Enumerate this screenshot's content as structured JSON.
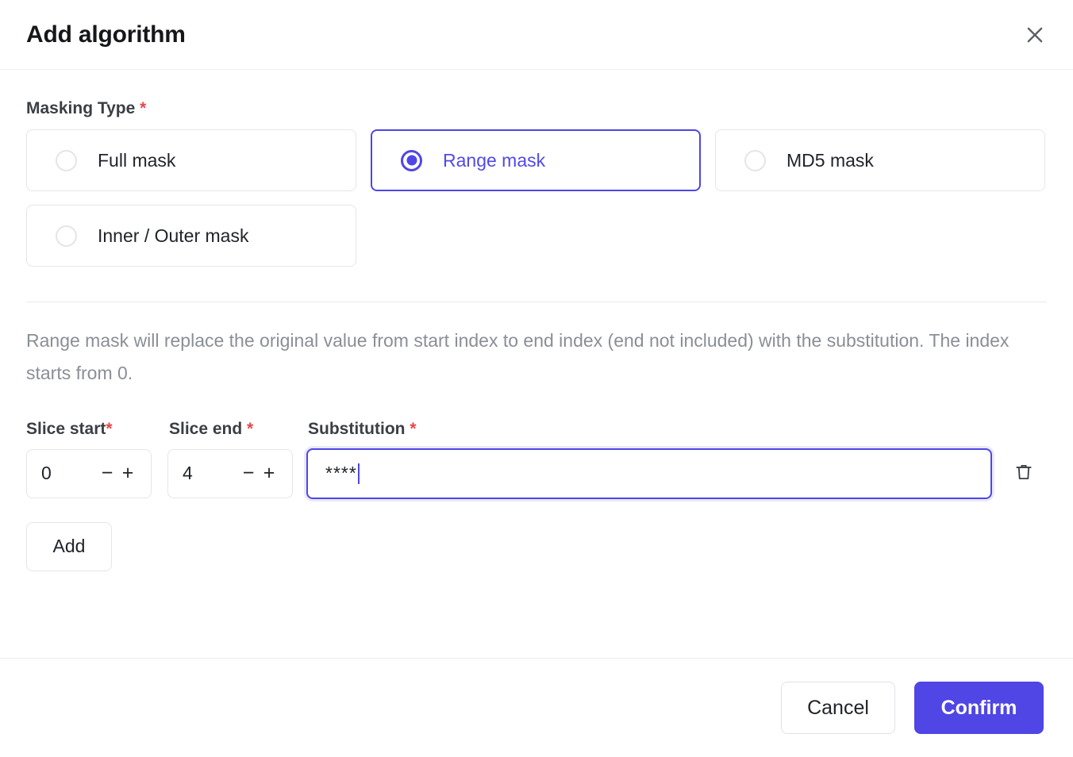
{
  "dialog": {
    "title": "Add algorithm",
    "close_icon": "close-icon"
  },
  "masking_type": {
    "label": "Masking Type",
    "required_marker": "*",
    "options": [
      {
        "label": "Full mask",
        "selected": false
      },
      {
        "label": "Range mask",
        "selected": true
      },
      {
        "label": "MD5 mask",
        "selected": false
      },
      {
        "label": "Inner / Outer mask",
        "selected": false
      }
    ]
  },
  "description": "Range mask will replace the original value from start index to end index (end not included) with the substitution. The index starts from 0.",
  "rule_row": {
    "slice_start": {
      "label": "Slice start",
      "required_marker": "*",
      "value": "0",
      "decrement": "−",
      "increment": "+"
    },
    "slice_end": {
      "label": "Slice end ",
      "required_marker": "*",
      "value": "4",
      "decrement": "−",
      "increment": "+"
    },
    "substitution": {
      "label": "Substitution ",
      "required_marker": "*",
      "value": "****",
      "placeholder": ""
    },
    "delete_icon": "trash-icon"
  },
  "add_button_label": "Add",
  "footer": {
    "cancel_label": "Cancel",
    "confirm_label": "Confirm"
  },
  "colors": {
    "accent": "#4f46e5",
    "required": "#e5484d",
    "border": "#e4e6e9",
    "muted_text": "#8a8f96"
  }
}
